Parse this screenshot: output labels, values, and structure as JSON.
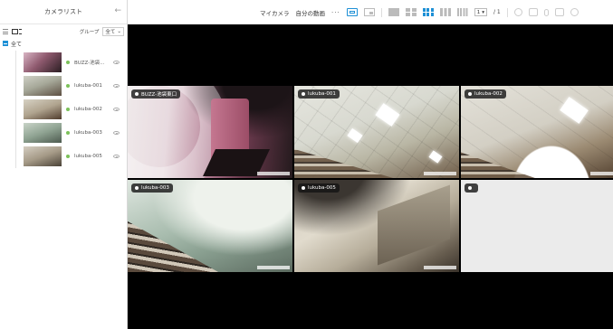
{
  "sidebar": {
    "title": "カメラリスト",
    "collapse_icon": "←",
    "group_label": "グループ",
    "group_select": "全て",
    "all_label": "全て",
    "cameras": [
      {
        "name": "BUZZ-池袋..."
      },
      {
        "name": "lukuba-001"
      },
      {
        "name": "lukuba-002"
      },
      {
        "name": "lukuba-003"
      },
      {
        "name": "lukuba-005"
      }
    ]
  },
  "toolbar": {
    "my_camera": "マイカメラ",
    "my_videos": "自分の動画",
    "more": "···",
    "page_value": "1",
    "page_total": "/ 1"
  },
  "tiles": [
    {
      "label": "BUZZ-池袋東口"
    },
    {
      "label": "lukuba-001"
    },
    {
      "label": "lukuba-002"
    },
    {
      "label": "lukuba-003"
    },
    {
      "label": "lukuba-005"
    },
    {
      "label": ""
    }
  ],
  "colors": {
    "accent": "#1e90d6",
    "status_online": "#7cc15a",
    "video_bg": "#000000"
  }
}
